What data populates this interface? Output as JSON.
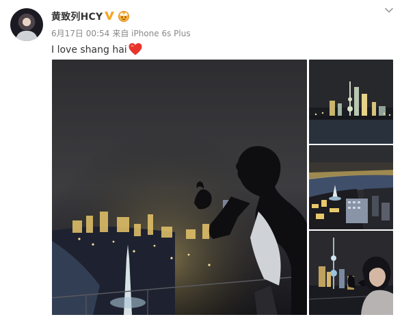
{
  "post": {
    "username": "黄致列HCY",
    "date": "6月17日 00:54",
    "source": "来自 iPhone 6s Plus",
    "text": "I love shang hai"
  },
  "icons": {
    "verified": "verified-v-badge-icon",
    "crown": "member-crown-icon",
    "menu": "chevron-down-icon",
    "emoji": "red-heart-emoji"
  },
  "colors": {
    "username": "#333333",
    "meta": "#888888",
    "verified_badge": "#f5a623",
    "heart": "#e8352c"
  },
  "photos": [
    "night-skyline-silhouette-main",
    "pudong-skyline-night",
    "river-aerial-night",
    "oriental-pearl-tower-selfie"
  ]
}
